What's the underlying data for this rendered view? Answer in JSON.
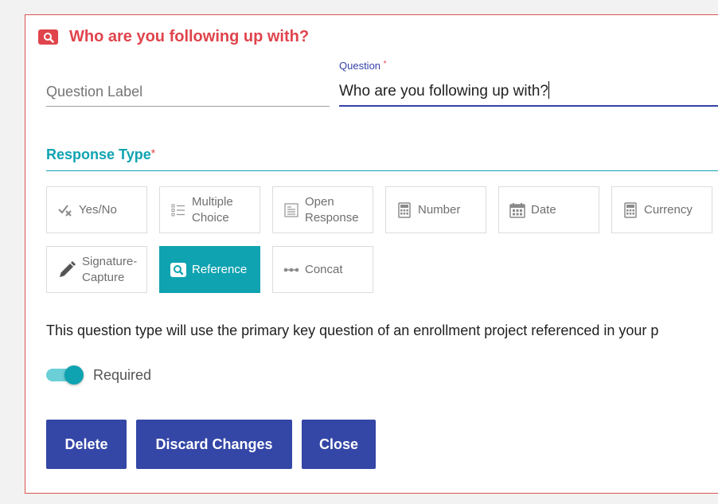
{
  "header": {
    "title": "Who are you following up with?",
    "icon": "search-icon",
    "color": "#e0444c"
  },
  "question_label": {
    "placeholder": "Question Label",
    "value": ""
  },
  "question": {
    "label": "Question",
    "required_marker": "*",
    "value": "Who are you following up with?"
  },
  "response_type": {
    "title": "Response Type",
    "required_marker": "*",
    "accent": "#0fa3b1"
  },
  "tiles": [
    {
      "label": "Yes/No",
      "icon": "yes-no-icon",
      "selected": false
    },
    {
      "label": "Multiple Choice",
      "icon": "list-icon",
      "selected": false
    },
    {
      "label": "Open Response",
      "icon": "text-box-icon",
      "selected": false
    },
    {
      "label": "Number",
      "icon": "calculator-icon",
      "selected": false
    },
    {
      "label": "Date",
      "icon": "calendar-icon",
      "selected": false
    },
    {
      "label": "Currency",
      "icon": "calculator-icon",
      "selected": false
    },
    {
      "label": "Signature-Capture",
      "icon": "pen-icon",
      "selected": false
    },
    {
      "label": "Reference",
      "icon": "search-icon",
      "selected": true
    },
    {
      "label": "Concat",
      "icon": "dots-line-icon",
      "selected": false
    }
  ],
  "description": "This question type will use the primary key question of an enrollment project referenced in your p",
  "required": {
    "label": "Required",
    "on": true
  },
  "buttons": {
    "delete": "Delete",
    "discard": "Discard Changes",
    "close": "Close",
    "color": "#3446a6"
  }
}
